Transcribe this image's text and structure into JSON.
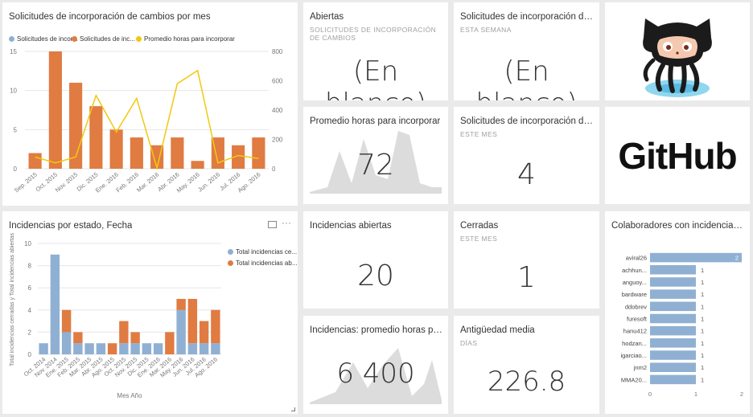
{
  "colors": {
    "blue": "#8fb0d3",
    "orange": "#e07b42",
    "yellow": "#f2c80f",
    "area": "#dcdcdc",
    "ink": "#333333"
  },
  "tiles": {
    "pr_monthly": {
      "title": "Solicitudes de incorporación de cambios por mes"
    },
    "abiertas": {
      "title": "Abiertas",
      "subtitle": "SOLICITUDES DE INCORPORACIÓN DE CAMBIOS",
      "value": "(En blanco)"
    },
    "pr_week": {
      "title": "Solicitudes de incorporación de c...",
      "subtitle": "ESTA SEMANA",
      "value": "(En blanco)"
    },
    "avg_hours": {
      "title": "Promedio horas para incorporar",
      "value": "72"
    },
    "pr_month": {
      "title": "Solicitudes de incorporación de c...",
      "subtitle": "ESTE MES",
      "value": "4"
    },
    "github_logo": {
      "wordmark": "GitHub"
    },
    "issues_status": {
      "title": "Incidencias por estado, Fecha"
    },
    "issues_open": {
      "title": "Incidencias abiertas",
      "value": "20"
    },
    "closed": {
      "title": "Cerradas",
      "subtitle": "ESTE MES",
      "value": "1"
    },
    "collaborators": {
      "title": "Colaboradores con incidencias ab..."
    },
    "issues_avg_hours": {
      "title": "Incidencias: promedio horas para c...",
      "value": "6 400"
    },
    "avg_age": {
      "title": "Antigüedad media",
      "subtitle": "DÍAS",
      "value": "226.8"
    }
  },
  "chart_data": [
    {
      "type": "bar",
      "title": "Solicitudes de incorporación de cambios por mes",
      "categories": [
        "Sep. 2015",
        "Oct. 2015",
        "Nov. 2015",
        "Dic. 2015",
        "Ene. 2016",
        "Feb. 2016",
        "Mar. 2016",
        "Abr. 2016",
        "May. 2016",
        "Jun. 2016",
        "Jul. 2016",
        "Ago. 2016"
      ],
      "legend": [
        "Solicitudes de incor...",
        "Solicitudes de inc...",
        "Promedio horas para incorporar"
      ],
      "series": [
        {
          "name": "Solicitudes de inc...",
          "axis": "left",
          "values": [
            2,
            15,
            11,
            8,
            5,
            4,
            3,
            4,
            1,
            4,
            3,
            4
          ]
        },
        {
          "name": "Promedio horas para incorporar",
          "type": "line",
          "axis": "right",
          "values": [
            80,
            40,
            80,
            500,
            250,
            480,
            5,
            580,
            670,
            40,
            90,
            70
          ]
        }
      ],
      "ylim": [
        0,
        15
      ],
      "yticks": [
        0,
        5,
        10,
        15
      ],
      "y2lim": [
        0,
        800
      ],
      "y2ticks": [
        0,
        200,
        400,
        600,
        800
      ],
      "legend_position": "top-left"
    },
    {
      "type": "bar",
      "title": "Incidencias por estado, Fecha",
      "stacked": true,
      "xlabel": "Mes Año",
      "ylabel": "Total incidencias cerradas y Total incidencias abiertas",
      "categories": [
        "Oct. 2014",
        "Nov. 2014",
        "Ene. 2015",
        "Feb. 2015",
        "Mar. 2015",
        "Abr. 2015",
        "Ago. 2015",
        "Oct. 2015",
        "Nov. 2015",
        "Dic. 2015",
        "Ene. 2016",
        "Mar. 2016",
        "May. 2016",
        "Jun. 2016",
        "Jul. 2016",
        "Ago. 2016"
      ],
      "tick_labels": [
        "Oct. 2014",
        "Nov. 2014",
        "Ene. 2015",
        "Feb. 2015",
        "Mar. 2015",
        "Abr. 2015",
        "Ago. 2015",
        "Oct. 2015",
        "Nov. 2015",
        "Dic. 2015",
        "Ene. 2016",
        "Mar. 2016",
        "May. 2016",
        "Jun. 2016",
        "Jul. 2016",
        "Ago. 2016"
      ],
      "legend": [
        "Total incidencias ce...",
        "Total incidencias ab..."
      ],
      "series": [
        {
          "name": "Total incidencias ce...",
          "values": [
            1,
            9,
            2,
            1,
            1,
            1,
            0,
            1,
            1,
            1,
            1,
            0,
            4,
            1,
            1,
            1
          ]
        },
        {
          "name": "Total incidencias ab...",
          "values": [
            0,
            0,
            2,
            1,
            0,
            0,
            1,
            2,
            1,
            0,
            0,
            2,
            1,
            4,
            2,
            3
          ]
        }
      ],
      "ylim": [
        0,
        10
      ],
      "yticks": [
        0,
        2,
        4,
        6,
        8,
        10
      ],
      "legend_position": "top-right"
    },
    {
      "type": "bar",
      "orientation": "horizontal",
      "title": "Colaboradores con incidencias ab...",
      "categories": [
        "aviral26",
        "achhun...",
        "anguoy...",
        "bardware",
        "ddobrev",
        "furesoft",
        "hanu412",
        "hodzan...",
        "igarciao...",
        "jnm2",
        "MMA20..."
      ],
      "values": [
        2,
        1,
        1,
        1,
        1,
        1,
        1,
        1,
        1,
        1,
        1
      ],
      "xlim": [
        0,
        2
      ],
      "xticks": [
        0,
        1,
        2
      ]
    }
  ]
}
